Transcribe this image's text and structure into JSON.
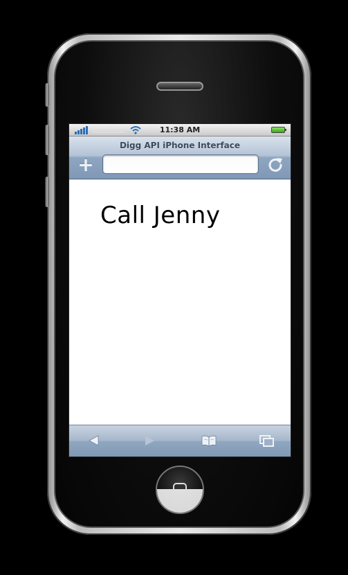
{
  "status_bar": {
    "time": "11:38 AM"
  },
  "browser": {
    "title": "Digg API iPhone Interface",
    "url_value": "",
    "add_label": "+"
  },
  "content": {
    "note_text": "Call Jenny"
  },
  "toolbar": {
    "back_icon": "back-arrow-icon",
    "forward_icon": "forward-arrow-icon",
    "bookmarks_icon": "bookmarks-book-icon",
    "pages_icon": "pages-icon"
  },
  "colors": {
    "nav_accent": "#7f98b6",
    "signal": "#2a6fb6",
    "battery": "#3aa815"
  }
}
